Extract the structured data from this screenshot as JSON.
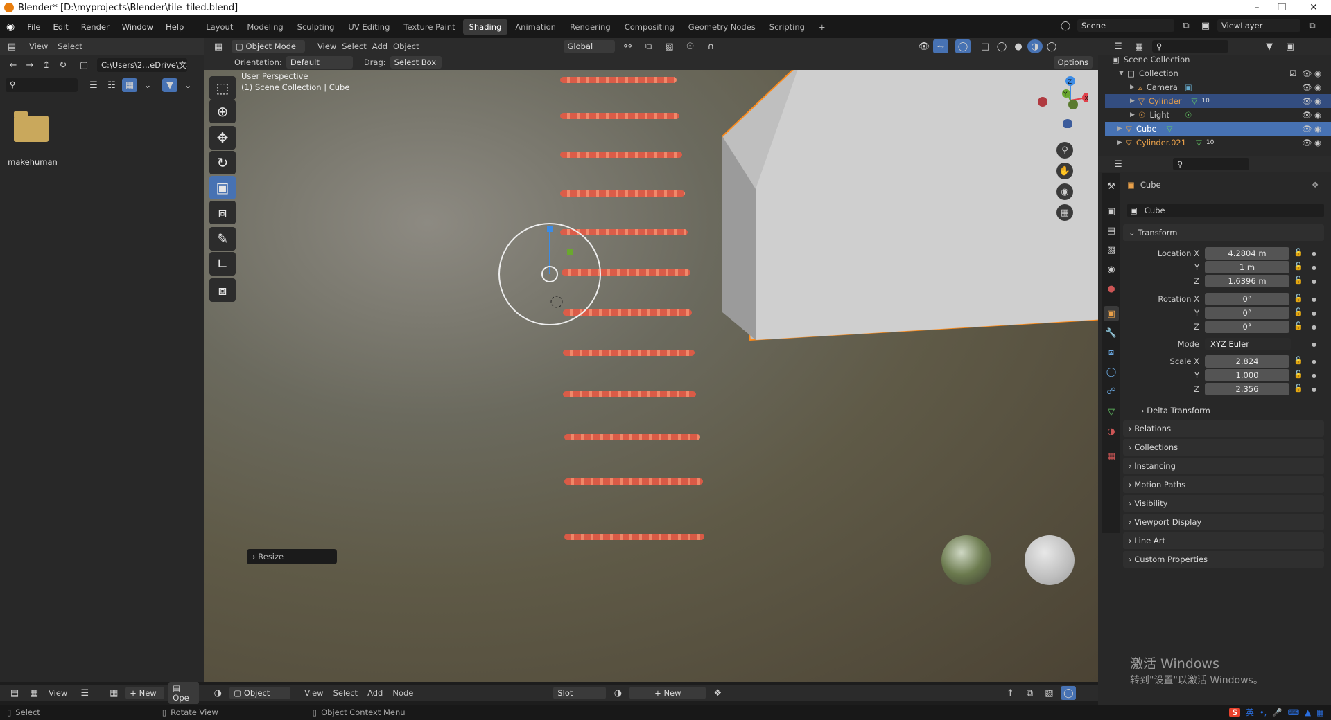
{
  "window": {
    "title": "Blender* [D:\\myprojects\\Blender\\tile_tiled.blend]"
  },
  "menu": [
    "File",
    "Edit",
    "Render",
    "Window",
    "Help"
  ],
  "workspaces": [
    "Layout",
    "Modeling",
    "Sculpting",
    "UV Editing",
    "Texture Paint",
    "Shading",
    "Animation",
    "Rendering",
    "Compositing",
    "Geometry Nodes",
    "Scripting"
  ],
  "workspace_add": "+",
  "scene": {
    "name": "Scene",
    "view_layer": "ViewLayer"
  },
  "file_browser": {
    "view_label": "View",
    "select_label": "Select",
    "path": "C:\\Users\\2...eDrive\\文档\\",
    "folder_name": "makehuman"
  },
  "viewport": {
    "mode": "Object Mode",
    "menus": [
      "View",
      "Select",
      "Add",
      "Object"
    ],
    "transform_orientation": "Global",
    "orientation_label": "Orientation:",
    "orientation_value": "Default",
    "drag_label": "Drag:",
    "drag_value": "Select Box",
    "options_label": "Options",
    "info_line1": "User Perspective",
    "info_line2": "(1) Scene Collection | Cube",
    "last_op": "Resize",
    "gizmo_axes": {
      "z": "Z",
      "y": "Y",
      "x": "X"
    }
  },
  "outliner": {
    "root": "Scene Collection",
    "items": [
      {
        "name": "Collection",
        "indent": 1
      },
      {
        "name": "Camera",
        "indent": 2
      },
      {
        "name": "Cylinder",
        "indent": 2,
        "badge": "10"
      },
      {
        "name": "Light",
        "indent": 2
      },
      {
        "name": "Cube",
        "indent": 1
      },
      {
        "name": "Cylinder.021",
        "indent": 1,
        "badge": "10"
      }
    ]
  },
  "properties": {
    "object_name": "Cube",
    "object_field": "Cube",
    "transform_title": "Transform",
    "location_label": "Location X",
    "location": [
      "4.2804 m",
      "1 m",
      "1.6396 m"
    ],
    "rotation_label": "Rotation X",
    "rotation": [
      "0°",
      "0°",
      "0°"
    ],
    "y_label": "Y",
    "z_label": "Z",
    "mode_label": "Mode",
    "mode_value": "XYZ Euler",
    "scale_label": "Scale X",
    "scale": [
      "2.824",
      "1.000",
      "2.356"
    ],
    "delta": "Delta Transform",
    "panels": [
      "Relations",
      "Collections",
      "Instancing",
      "Motion Paths",
      "Visibility",
      "Viewport Display",
      "Line Art",
      "Custom Properties"
    ]
  },
  "shader_header": {
    "new_label": "New",
    "open_label": "Ope",
    "object_label": "Object",
    "menus": [
      "View",
      "Select",
      "Add",
      "Node"
    ],
    "slot_label": "Slot",
    "new_material": "New"
  },
  "activation": {
    "line1": "激活 Windows",
    "line2": "转到\"设置\"以激活 Windows。"
  },
  "statusbar": [
    "Select",
    "Rotate View",
    "Object Context Menu"
  ],
  "ime": {
    "text": "英"
  }
}
